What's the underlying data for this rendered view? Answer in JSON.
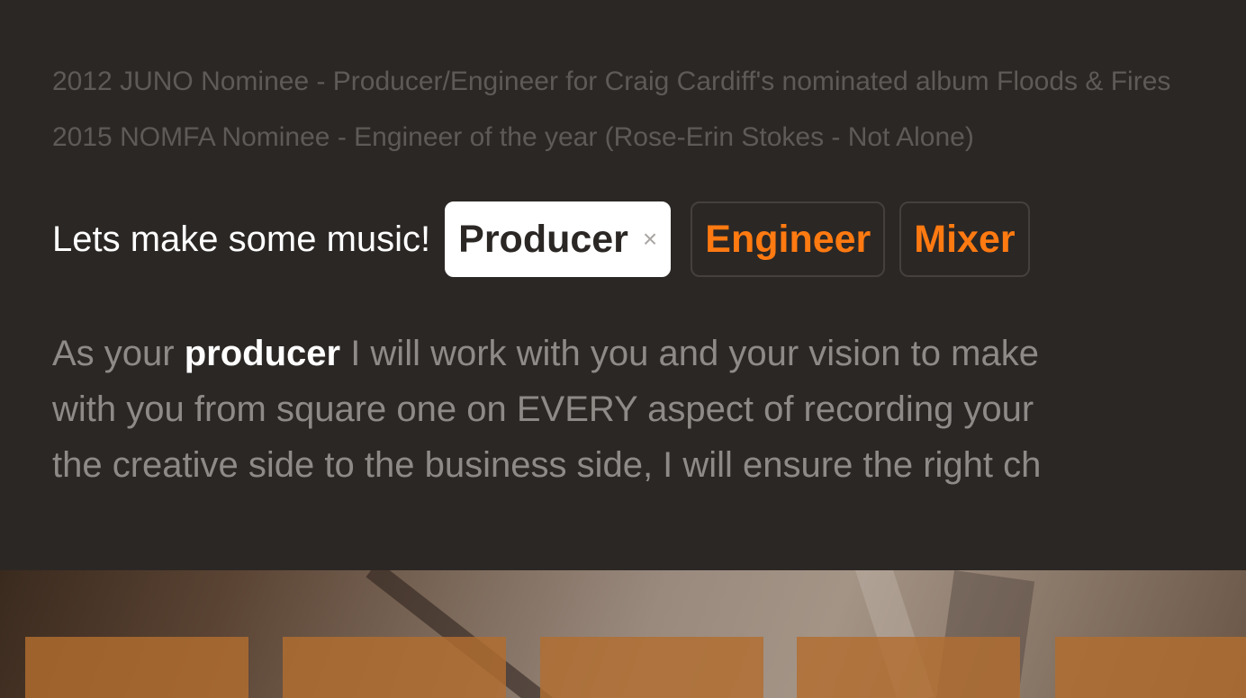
{
  "awards": [
    "2012 JUNO Nominee - Producer/Engineer for Craig Cardiff's nominated album Floods & Fires",
    "2015 NOMFA Nominee - Engineer of the year (Rose-Erin Stokes - Not Alone)"
  ],
  "cta": {
    "text": "Lets make some music!",
    "tags": [
      {
        "label": "Producer",
        "active": true,
        "close": "×"
      },
      {
        "label": "Engineer",
        "active": false
      },
      {
        "label": "Mixer",
        "active": false
      }
    ]
  },
  "description": {
    "line1_prefix": "As your ",
    "line1_bold": "producer",
    "line1_rest": " I will work with you and your vision to make",
    "line2": "with you from square one on EVERY aspect of recording your",
    "line3": "the creative side to the business side, I will ensure the right ch"
  },
  "colors": {
    "background": "#2b2725",
    "accent": "#ff7a11",
    "muted_text": "#8e8a87",
    "award_text": "#5e5a57"
  }
}
